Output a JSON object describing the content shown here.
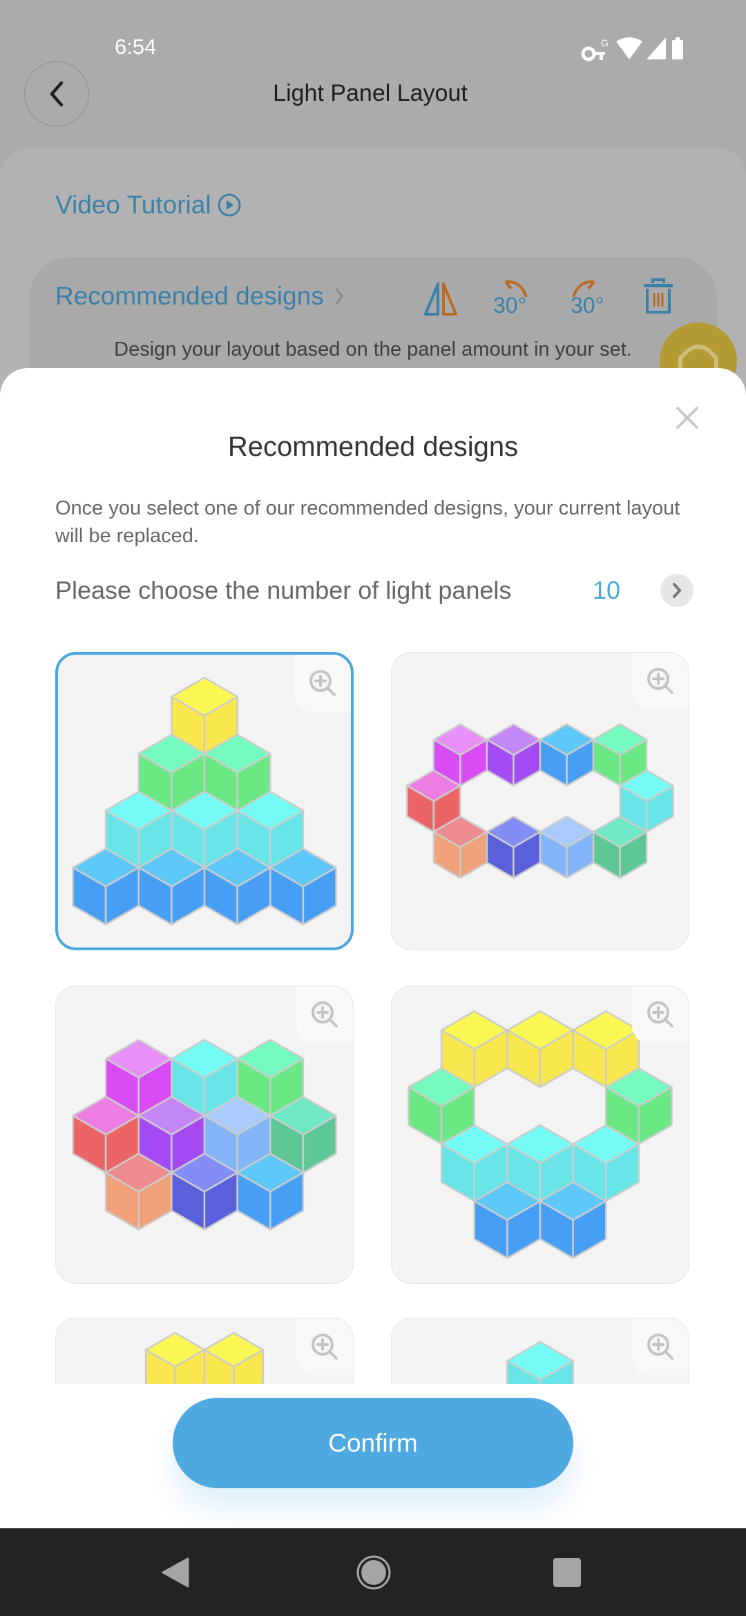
{
  "status_bar": {
    "time": "6:54",
    "icons": [
      "vpn-key-icon",
      "wifi-icon",
      "signal-icon",
      "battery-icon"
    ]
  },
  "header": {
    "title": "Light Panel Layout",
    "back_icon": "chevron-left-icon"
  },
  "page": {
    "video_tutorial": "Video Tutorial",
    "recommended_link": "Recommended designs",
    "tools": {
      "mirror": "mirror-icon",
      "rotate_ccw_label": "30°",
      "rotate_cw_label": "30°",
      "delete": "trash-icon"
    },
    "hint": "Design your layout based on the panel amount in your set."
  },
  "modal": {
    "title": "Recommended designs",
    "description": "Once you select one of our recommended designs, your current layout will be replaced.",
    "choose_label": "Please choose the number of light panels",
    "panel_count": "10",
    "confirm_label": "Confirm"
  },
  "colors": {
    "accent": "#4AA6DE",
    "cube_stroke": "#CCCCCC",
    "palette": {
      "yellow": {
        "top": "#FCF853",
        "side": "#F8E74E"
      },
      "green": {
        "top": "#74F9BF",
        "side": "#6BE884"
      },
      "cyan": {
        "top": "#74FCF4",
        "side": "#68E4E6"
      },
      "blue": {
        "top": "#5EC8F8",
        "side": "#479FF5"
      },
      "magenta": {
        "top": "#E890F8",
        "side": "#D84BF5"
      },
      "purple": {
        "top": "#C487F8",
        "side": "#A54BF3"
      },
      "red": {
        "top": "#EE7DE3",
        "side": "#EB6566"
      },
      "salmon": {
        "top": "#EE8B8C",
        "side": "#F2A27A"
      },
      "indigo": {
        "top": "#848DF6",
        "side": "#5A60DC"
      },
      "lightblue": {
        "top": "#A8CBFB",
        "side": "#83B5F8"
      },
      "teal": {
        "top": "#70E8C4",
        "side": "#5DC796"
      }
    }
  },
  "designs": [
    {
      "selected": true,
      "cubes": [
        "yellow",
        "green",
        "green",
        "cyan",
        "cyan",
        "cyan",
        "blue",
        "blue",
        "blue",
        "blue"
      ]
    },
    {
      "selected": false,
      "cubes": [
        "magenta",
        "purple",
        "blue",
        "green",
        "red",
        "cyan",
        "salmon",
        "indigo",
        "lightblue",
        "teal"
      ]
    },
    {
      "selected": false,
      "cubes": [
        "magenta",
        "cyan",
        "green",
        "red",
        "purple",
        "lightblue",
        "teal",
        "salmon",
        "indigo",
        "blue"
      ]
    },
    {
      "selected": false,
      "cubes": [
        "yellow",
        "yellow",
        "yellow",
        "green",
        "green",
        "cyan",
        "cyan",
        "cyan",
        "blue",
        "blue"
      ]
    },
    {
      "selected": false,
      "cubes": [
        "yellow",
        "yellow"
      ]
    },
    {
      "selected": false,
      "cubes": [
        "cyan"
      ]
    }
  ]
}
